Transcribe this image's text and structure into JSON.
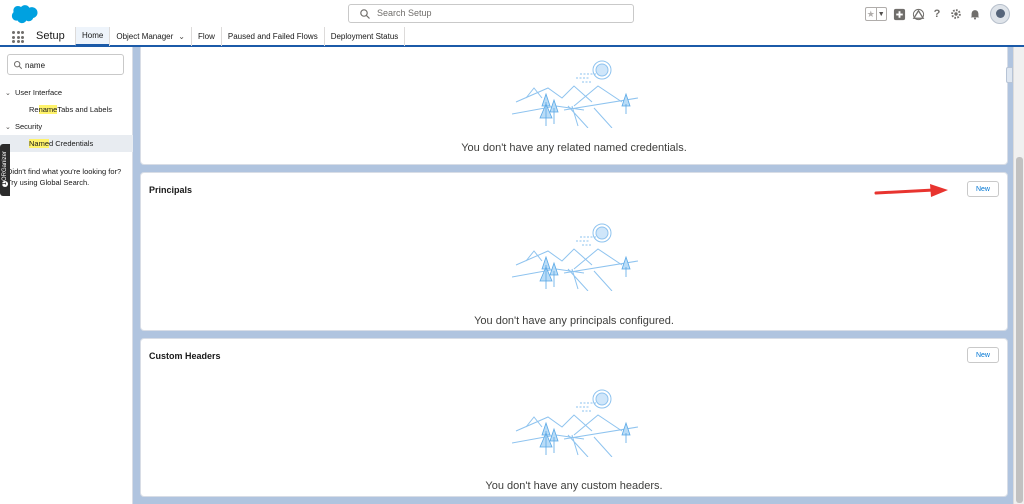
{
  "header": {
    "search_placeholder": "Search Setup"
  },
  "nav": {
    "app_name": "Setup",
    "tabs": [
      {
        "label": "Home"
      },
      {
        "label": "Object Manager"
      },
      {
        "label": "Flow"
      },
      {
        "label": "Paused and Failed Flows"
      },
      {
        "label": "Deployment Status"
      }
    ]
  },
  "sidebar": {
    "quick_find_value": "name",
    "groups": [
      {
        "label": "User Interface",
        "item_pre": "Re",
        "item_hl": "name",
        "item_post": " Tabs and Labels"
      },
      {
        "label": "Security",
        "item_pre": "",
        "item_hl": "Name",
        "item_post": "d Credentials"
      }
    ],
    "help_line1": "Didn't find what you're looking for?",
    "help_line2": "Try using Global Search.",
    "org_badge": "ORGanizer",
    "org_badge_count": "1"
  },
  "main": {
    "card1_message": "You don't have any related named credentials.",
    "principals": {
      "title": "Principals",
      "new_label": "New",
      "message": "You don't have any principals configured."
    },
    "custom_headers": {
      "title": "Custom Headers",
      "new_label": "New",
      "message": "You don't have any custom headers."
    }
  },
  "colors": {
    "brand_blue": "#1b5aa8",
    "link_blue": "#0176d3",
    "page_bg": "#b0c4df",
    "annotation_arrow": "#e8342f"
  }
}
